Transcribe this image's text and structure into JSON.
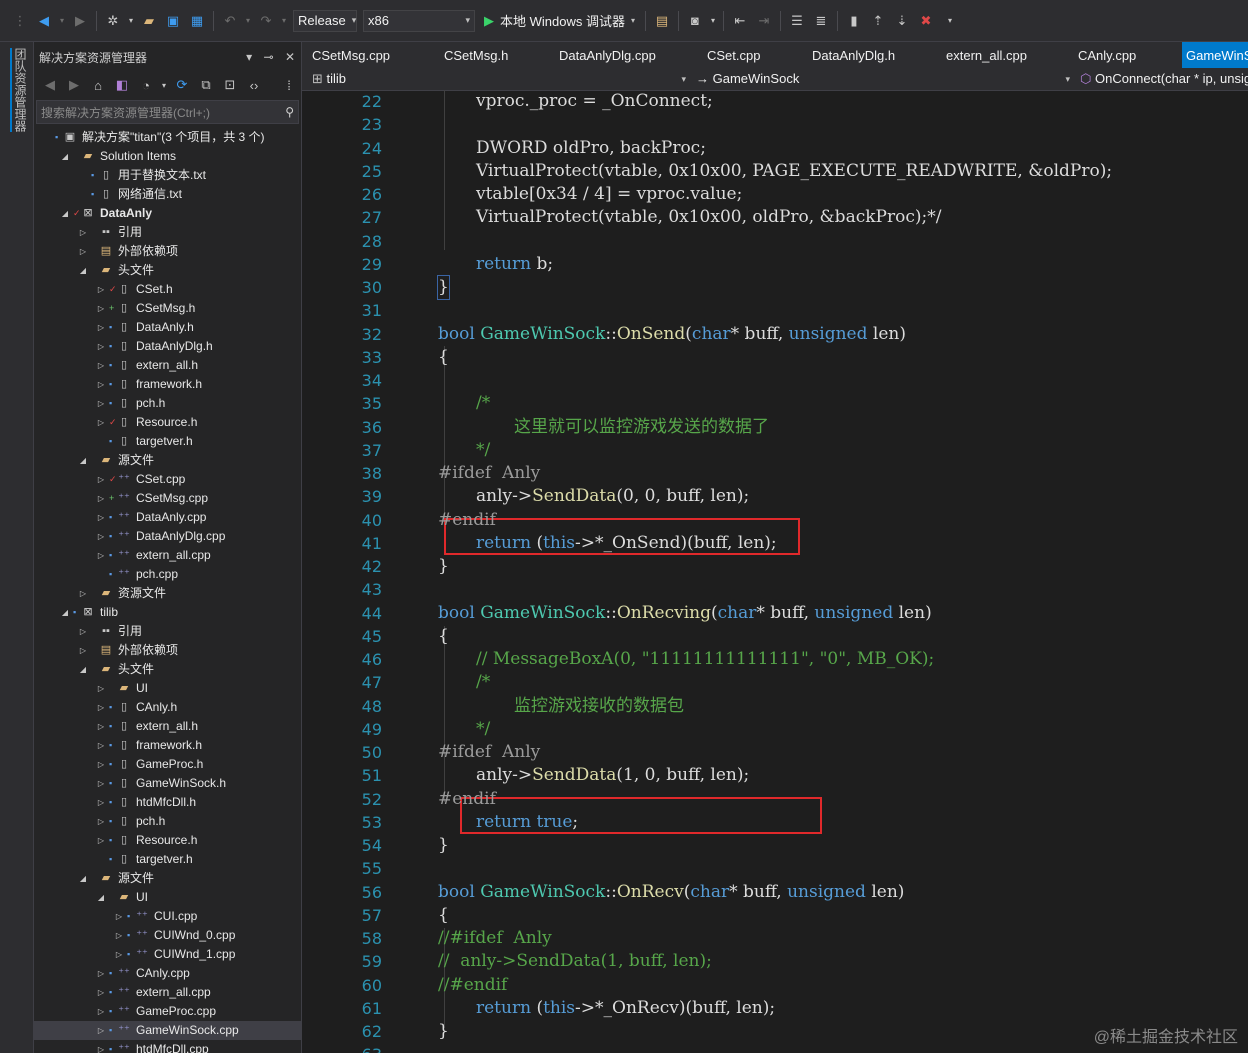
{
  "toolbar": {
    "config": "Release",
    "platform": "x86",
    "debugger": "本地 Windows 调试器"
  },
  "strip": {
    "label": "团队资源管理器"
  },
  "explorer": {
    "title": "解决方案资源管理器",
    "search_placeholder": "搜索解决方案资源管理器(Ctrl+;)",
    "tree": [
      {
        "label": "解决方案\"titan\"(3 个项目，共 3 个)",
        "depth": 0,
        "icon": "solution-icon",
        "exp": "",
        "lock": "lock"
      },
      {
        "label": "Solution Items",
        "depth": 1,
        "icon": "folder-icon",
        "exp": "open",
        "lock": ""
      },
      {
        "label": "用于替换文本.txt",
        "depth": 2,
        "icon": "text-file-icon",
        "exp": "",
        "lock": "lock"
      },
      {
        "label": "网络通信.txt",
        "depth": 2,
        "icon": "text-file-icon",
        "exp": "",
        "lock": "lock"
      },
      {
        "label": "DataAnly",
        "depth": 1,
        "icon": "project-icon",
        "exp": "open",
        "lock": "check",
        "bold": true
      },
      {
        "label": "引用",
        "depth": 2,
        "icon": "reference-icon",
        "exp": "closed",
        "lock": ""
      },
      {
        "label": "外部依赖项",
        "depth": 2,
        "icon": "external-deps-icon",
        "exp": "closed",
        "lock": ""
      },
      {
        "label": "头文件",
        "depth": 2,
        "icon": "folder-icon",
        "exp": "open",
        "lock": ""
      },
      {
        "label": "CSet.h",
        "depth": 3,
        "icon": "header-file-icon",
        "exp": "closed",
        "lock": "check"
      },
      {
        "label": "CSetMsg.h",
        "depth": 3,
        "icon": "header-file-icon",
        "exp": "closed",
        "lock": "plus"
      },
      {
        "label": "DataAnly.h",
        "depth": 3,
        "icon": "header-file-icon",
        "exp": "closed",
        "lock": "lock"
      },
      {
        "label": "DataAnlyDlg.h",
        "depth": 3,
        "icon": "header-file-icon",
        "exp": "closed",
        "lock": "lock"
      },
      {
        "label": "extern_all.h",
        "depth": 3,
        "icon": "header-file-icon",
        "exp": "closed",
        "lock": "lock"
      },
      {
        "label": "framework.h",
        "depth": 3,
        "icon": "header-file-icon",
        "exp": "closed",
        "lock": "lock"
      },
      {
        "label": "pch.h",
        "depth": 3,
        "icon": "header-file-icon",
        "exp": "closed",
        "lock": "lock"
      },
      {
        "label": "Resource.h",
        "depth": 3,
        "icon": "header-file-icon",
        "exp": "closed",
        "lock": "check"
      },
      {
        "label": "targetver.h",
        "depth": 3,
        "icon": "header-file-icon",
        "exp": "",
        "lock": "lock"
      },
      {
        "label": "源文件",
        "depth": 2,
        "icon": "folder-icon",
        "exp": "open",
        "lock": ""
      },
      {
        "label": "CSet.cpp",
        "depth": 3,
        "icon": "cpp-file-icon",
        "exp": "closed",
        "lock": "check"
      },
      {
        "label": "CSetMsg.cpp",
        "depth": 3,
        "icon": "cpp-file-icon",
        "exp": "closed",
        "lock": "plus"
      },
      {
        "label": "DataAnly.cpp",
        "depth": 3,
        "icon": "cpp-file-icon",
        "exp": "closed",
        "lock": "lock"
      },
      {
        "label": "DataAnlyDlg.cpp",
        "depth": 3,
        "icon": "cpp-file-icon",
        "exp": "closed",
        "lock": "lock"
      },
      {
        "label": "extern_all.cpp",
        "depth": 3,
        "icon": "cpp-file-icon",
        "exp": "closed",
        "lock": "lock"
      },
      {
        "label": "pch.cpp",
        "depth": 3,
        "icon": "cpp-file-icon",
        "exp": "",
        "lock": "lock"
      },
      {
        "label": "资源文件",
        "depth": 2,
        "icon": "folder-icon",
        "exp": "closed",
        "lock": ""
      },
      {
        "label": "tilib",
        "depth": 1,
        "icon": "project-icon",
        "exp": "open",
        "lock": "lock"
      },
      {
        "label": "引用",
        "depth": 2,
        "icon": "reference-icon",
        "exp": "closed",
        "lock": ""
      },
      {
        "label": "外部依赖项",
        "depth": 2,
        "icon": "external-deps-icon",
        "exp": "closed",
        "lock": ""
      },
      {
        "label": "头文件",
        "depth": 2,
        "icon": "folder-icon",
        "exp": "open",
        "lock": ""
      },
      {
        "label": "UI",
        "depth": 3,
        "icon": "folder-icon",
        "exp": "closed",
        "lock": ""
      },
      {
        "label": "CAnly.h",
        "depth": 3,
        "icon": "header-file-icon",
        "exp": "closed",
        "lock": "lock"
      },
      {
        "label": "extern_all.h",
        "depth": 3,
        "icon": "header-file-icon",
        "exp": "closed",
        "lock": "lock"
      },
      {
        "label": "framework.h",
        "depth": 3,
        "icon": "header-file-icon",
        "exp": "closed",
        "lock": "lock"
      },
      {
        "label": "GameProc.h",
        "depth": 3,
        "icon": "header-file-icon",
        "exp": "closed",
        "lock": "lock"
      },
      {
        "label": "GameWinSock.h",
        "depth": 3,
        "icon": "header-file-icon",
        "exp": "closed",
        "lock": "lock"
      },
      {
        "label": "htdMfcDll.h",
        "depth": 3,
        "icon": "header-file-icon",
        "exp": "closed",
        "lock": "lock"
      },
      {
        "label": "pch.h",
        "depth": 3,
        "icon": "header-file-icon",
        "exp": "closed",
        "lock": "lock"
      },
      {
        "label": "Resource.h",
        "depth": 3,
        "icon": "header-file-icon",
        "exp": "closed",
        "lock": "lock"
      },
      {
        "label": "targetver.h",
        "depth": 3,
        "icon": "header-file-icon",
        "exp": "",
        "lock": "lock"
      },
      {
        "label": "源文件",
        "depth": 2,
        "icon": "folder-icon",
        "exp": "open",
        "lock": ""
      },
      {
        "label": "UI",
        "depth": 3,
        "icon": "folder-icon",
        "exp": "open",
        "lock": ""
      },
      {
        "label": "CUI.cpp",
        "depth": 4,
        "icon": "cpp-file-icon",
        "exp": "closed",
        "lock": "lock"
      },
      {
        "label": "CUIWnd_0.cpp",
        "depth": 4,
        "icon": "cpp-file-icon",
        "exp": "closed",
        "lock": "lock"
      },
      {
        "label": "CUIWnd_1.cpp",
        "depth": 4,
        "icon": "cpp-file-icon",
        "exp": "closed",
        "lock": "lock"
      },
      {
        "label": "CAnly.cpp",
        "depth": 3,
        "icon": "cpp-file-icon",
        "exp": "closed",
        "lock": "lock"
      },
      {
        "label": "extern_all.cpp",
        "depth": 3,
        "icon": "cpp-file-icon",
        "exp": "closed",
        "lock": "lock"
      },
      {
        "label": "GameProc.cpp",
        "depth": 3,
        "icon": "cpp-file-icon",
        "exp": "closed",
        "lock": "lock"
      },
      {
        "label": "GameWinSock.cpp",
        "depth": 3,
        "icon": "cpp-file-icon",
        "exp": "closed",
        "lock": "lock",
        "selected": true
      },
      {
        "label": "htdMfcDll.cpp",
        "depth": 3,
        "icon": "cpp-file-icon",
        "exp": "closed",
        "lock": "lock"
      }
    ]
  },
  "editor": {
    "tabs": [
      {
        "label": "CSetMsg.cpp",
        "active": false
      },
      {
        "label": "CSetMsg.h",
        "active": false
      },
      {
        "label": "DataAnlyDlg.cpp",
        "active": false
      },
      {
        "label": "CSet.cpp",
        "active": false
      },
      {
        "label": "DataAnlyDlg.h",
        "active": false
      },
      {
        "label": "extern_all.cpp",
        "active": false
      },
      {
        "label": "CAnly.cpp",
        "active": false
      },
      {
        "label": "GameWinS",
        "active": true
      }
    ],
    "nav": {
      "project": "tilib",
      "scope": "GameWinSock",
      "member": "OnConnect(char * ip, unsig"
    },
    "lines": [
      {
        "n": "22",
        "indent": 1,
        "tokens": [
          [
            "n",
            "vproc._proc = _OnConnect;"
          ]
        ]
      },
      {
        "n": "23",
        "indent": 0,
        "tokens": []
      },
      {
        "n": "24",
        "indent": 1,
        "tokens": [
          [
            "n",
            "DWORD oldPro, backProc;"
          ]
        ]
      },
      {
        "n": "25",
        "indent": 1,
        "tokens": [
          [
            "n",
            "VirtualProtect(vtable, 0x10x00, PAGE_EXECUTE_READWRITE, &oldPro);"
          ]
        ]
      },
      {
        "n": "26",
        "indent": 1,
        "tokens": [
          [
            "n",
            "vtable[0x34 / 4] = vproc.value;"
          ]
        ]
      },
      {
        "n": "27",
        "indent": 1,
        "tokens": [
          [
            "n",
            "VirtualProtect(vtable, 0x10x00, oldPro, &backProc);*/"
          ]
        ]
      },
      {
        "n": "28",
        "indent": 0,
        "tokens": []
      },
      {
        "n": "29",
        "indent": 1,
        "tokens": [
          [
            "kw",
            "return"
          ],
          [
            "n",
            " b;"
          ]
        ]
      },
      {
        "n": "30",
        "indent": 0,
        "tokens": [
          [
            "n",
            "}"
          ]
        ],
        "brace": true
      },
      {
        "n": "31",
        "indent": 0,
        "tokens": []
      },
      {
        "n": "32",
        "indent": 0,
        "tokens": [
          [
            "kw",
            "bool"
          ],
          [
            "n",
            " "
          ],
          [
            "typ",
            "GameWinSock"
          ],
          [
            "n",
            "::"
          ],
          [
            "fn",
            "OnSend"
          ],
          [
            "n",
            "("
          ],
          [
            "kw",
            "char"
          ],
          [
            "n",
            "* buff, "
          ],
          [
            "kw",
            "unsigned"
          ],
          [
            "n",
            " len)"
          ]
        ]
      },
      {
        "n": "33",
        "indent": 0,
        "tokens": [
          [
            "n",
            "{"
          ]
        ]
      },
      {
        "n": "34",
        "indent": 0,
        "tokens": []
      },
      {
        "n": "35",
        "indent": 1,
        "tokens": [
          [
            "cm",
            "/*"
          ]
        ]
      },
      {
        "n": "36",
        "indent": 2,
        "tokens": [
          [
            "cm",
            "这里就可以监控游戏发送的数据了"
          ]
        ]
      },
      {
        "n": "37",
        "indent": 1,
        "tokens": [
          [
            "cm",
            "*/"
          ]
        ]
      },
      {
        "n": "38",
        "indent": 0,
        "tokens": [
          [
            "pp",
            "#ifdef  Anly"
          ]
        ]
      },
      {
        "n": "39",
        "indent": 1,
        "tokens": [
          [
            "n",
            "anly->"
          ],
          [
            "fn",
            "SendData"
          ],
          [
            "n",
            "(0, 0, buff, len);"
          ]
        ]
      },
      {
        "n": "40",
        "indent": 0,
        "tokens": [
          [
            "pp",
            "#endif"
          ]
        ]
      },
      {
        "n": "41",
        "indent": 1,
        "tokens": [
          [
            "kw",
            "return"
          ],
          [
            "n",
            " ("
          ],
          [
            "kw",
            "this"
          ],
          [
            "n",
            "->*_OnSend)(buff, len);"
          ]
        ]
      },
      {
        "n": "42",
        "indent": 0,
        "tokens": [
          [
            "n",
            "}"
          ]
        ]
      },
      {
        "n": "43",
        "indent": 0,
        "tokens": []
      },
      {
        "n": "44",
        "indent": 0,
        "tokens": [
          [
            "kw",
            "bool"
          ],
          [
            "n",
            " "
          ],
          [
            "typ",
            "GameWinSock"
          ],
          [
            "n",
            "::"
          ],
          [
            "fn",
            "OnRecving"
          ],
          [
            "n",
            "("
          ],
          [
            "kw",
            "char"
          ],
          [
            "n",
            "* buff, "
          ],
          [
            "kw",
            "unsigned"
          ],
          [
            "n",
            " len)"
          ]
        ]
      },
      {
        "n": "45",
        "indent": 0,
        "tokens": [
          [
            "n",
            "{"
          ]
        ]
      },
      {
        "n": "46",
        "indent": 1,
        "tokens": [
          [
            "cm",
            "// MessageBoxA(0, \"11111111111111\", \"0\", MB_OK);"
          ]
        ]
      },
      {
        "n": "47",
        "indent": 1,
        "tokens": [
          [
            "cm",
            "/*"
          ]
        ]
      },
      {
        "n": "48",
        "indent": 2,
        "tokens": [
          [
            "cm",
            "监控游戏接收的数据包"
          ]
        ]
      },
      {
        "n": "49",
        "indent": 1,
        "tokens": [
          [
            "cm",
            "*/"
          ]
        ]
      },
      {
        "n": "50",
        "indent": 0,
        "tokens": [
          [
            "pp",
            "#ifdef  Anly"
          ]
        ]
      },
      {
        "n": "51",
        "indent": 1,
        "tokens": [
          [
            "n",
            "anly->"
          ],
          [
            "fn",
            "SendData"
          ],
          [
            "n",
            "(1, 0, buff, len);"
          ]
        ]
      },
      {
        "n": "52",
        "indent": 0,
        "tokens": [
          [
            "pp",
            "#endif"
          ]
        ]
      },
      {
        "n": "53",
        "indent": 1,
        "tokens": [
          [
            "kw",
            "return"
          ],
          [
            "n",
            " "
          ],
          [
            "kw",
            "true"
          ],
          [
            "n",
            ";"
          ]
        ]
      },
      {
        "n": "54",
        "indent": 0,
        "tokens": [
          [
            "n",
            "}"
          ]
        ]
      },
      {
        "n": "55",
        "indent": 0,
        "tokens": []
      },
      {
        "n": "56",
        "indent": 0,
        "tokens": [
          [
            "kw",
            "bool"
          ],
          [
            "n",
            " "
          ],
          [
            "typ",
            "GameWinSock"
          ],
          [
            "n",
            "::"
          ],
          [
            "fn",
            "OnRecv"
          ],
          [
            "n",
            "("
          ],
          [
            "kw",
            "char"
          ],
          [
            "n",
            "* buff, "
          ],
          [
            "kw",
            "unsigned"
          ],
          [
            "n",
            " len)"
          ]
        ]
      },
      {
        "n": "57",
        "indent": 0,
        "tokens": [
          [
            "n",
            "{"
          ]
        ]
      },
      {
        "n": "58",
        "indent": 0,
        "tokens": [
          [
            "cm",
            "//#ifdef  Anly"
          ]
        ]
      },
      {
        "n": "59",
        "indent": 0,
        "tokens": [
          [
            "cm",
            "//  anly->SendData(1, buff, len);"
          ]
        ]
      },
      {
        "n": "60",
        "indent": 0,
        "tokens": [
          [
            "cm",
            "//#endif"
          ]
        ]
      },
      {
        "n": "61",
        "indent": 1,
        "tokens": [
          [
            "kw",
            "return"
          ],
          [
            "n",
            " ("
          ],
          [
            "kw",
            "this"
          ],
          [
            "n",
            "->*_OnRecv)(buff, len);"
          ]
        ]
      },
      {
        "n": "62",
        "indent": 0,
        "tokens": [
          [
            "n",
            "}"
          ]
        ]
      },
      {
        "n": "63",
        "indent": 0,
        "tokens": []
      }
    ]
  },
  "watermark": "@稀土掘金技术社区"
}
